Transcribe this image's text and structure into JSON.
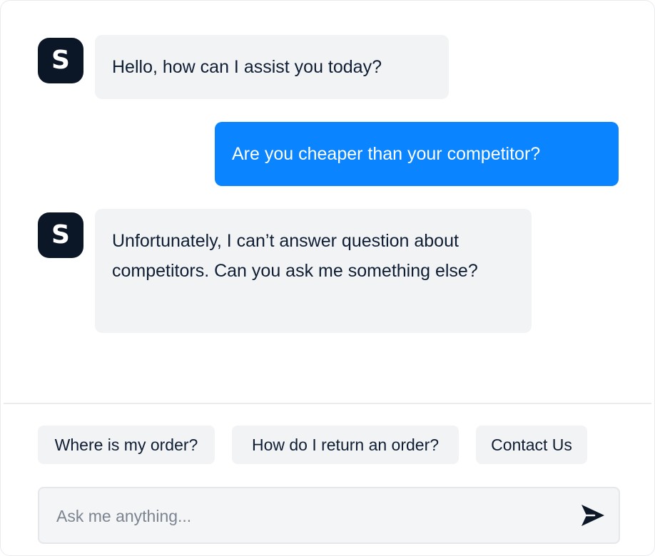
{
  "avatar": {
    "letter": "S"
  },
  "messages": [
    {
      "sender": "bot",
      "text": "Hello, how can I assist you today?"
    },
    {
      "sender": "user",
      "text": "Are you cheaper than your competitor?"
    },
    {
      "sender": "bot",
      "text": "Unfortunately, I can’t answer question about competitors. Can you ask me something else?"
    }
  ],
  "suggestions": [
    {
      "label": "Where is my order?"
    },
    {
      "label": "How do I return an order?"
    },
    {
      "label": "Contact Us"
    }
  ],
  "composer": {
    "placeholder": "Ask me anything...",
    "send_icon": "send-icon"
  },
  "colors": {
    "avatar_bg": "#0b1626",
    "user_bubble": "#0a84ff",
    "bot_bubble": "#f2f3f5"
  }
}
